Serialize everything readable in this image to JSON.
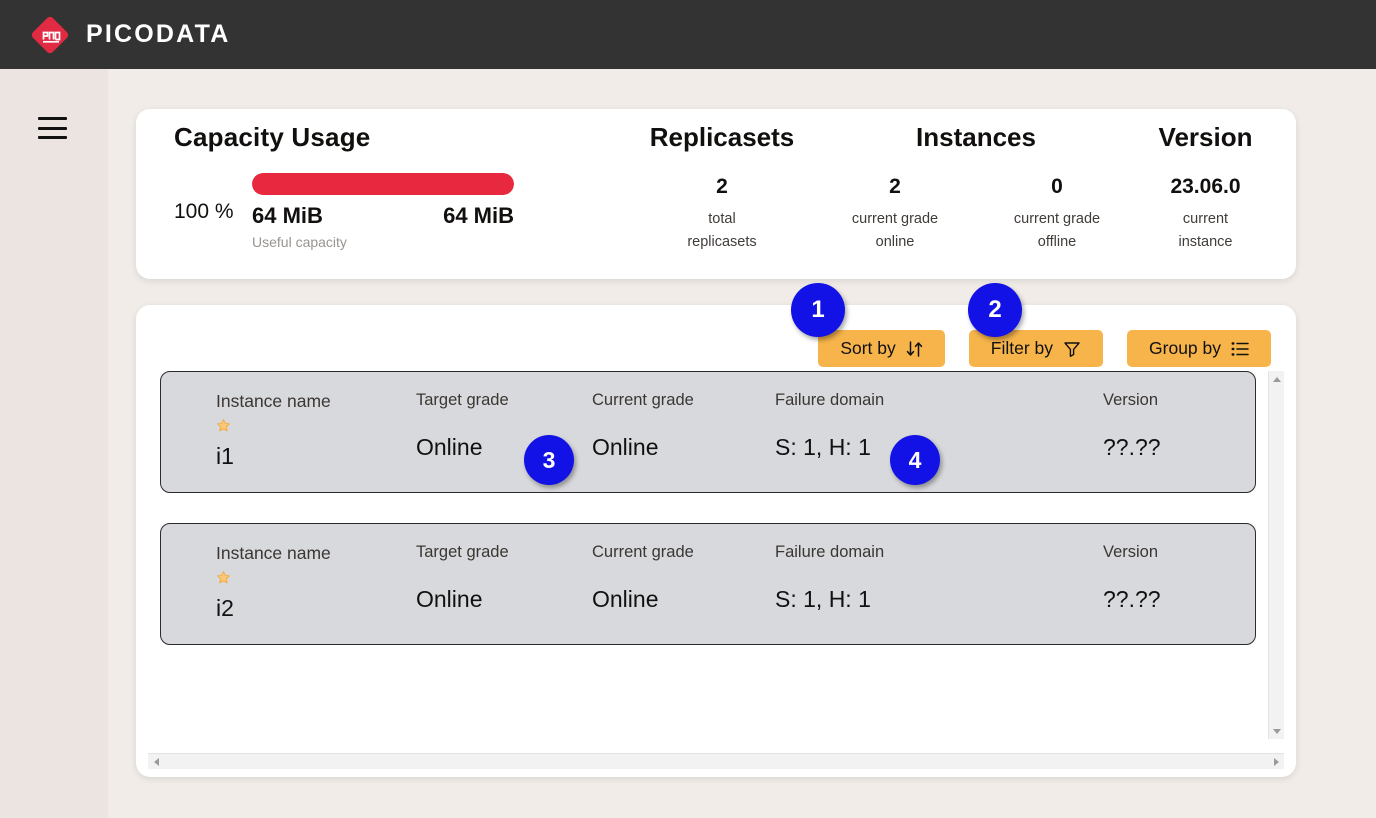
{
  "topbar": {
    "brand": "PICODATA",
    "logo_icon": "picodata-diamond-logo",
    "bg_color": "#333333"
  },
  "sidebar": {
    "menu_icon": "hamburger-menu-icon",
    "bg_color": "#ece4e0"
  },
  "summary": {
    "capacity": {
      "title": "Capacity Usage",
      "percent_label": "100 %",
      "percent_value": 100,
      "used": "64 MiB",
      "total": "64 MiB",
      "sub_label": "Useful capacity",
      "bar_color": "#e8283f"
    },
    "replicasets": {
      "title": "Replicasets",
      "items": [
        {
          "value": "2",
          "label": "total\nreplicasets"
        }
      ]
    },
    "instances": {
      "title": "Instances",
      "items": [
        {
          "value": "2",
          "label": "current grade\nonline"
        },
        {
          "value": "0",
          "label": "current grade\noffline"
        }
      ]
    },
    "version": {
      "title": "Version",
      "items": [
        {
          "value": "23.06.0",
          "label": "current\ninstance"
        }
      ]
    }
  },
  "toolbar": {
    "accent_color": "#f6b44a",
    "buttons": [
      {
        "label": "Sort by",
        "icon": "sort-arrows-icon",
        "name": "sort-by-button"
      },
      {
        "label": "Filter by",
        "icon": "funnel-filter-icon",
        "name": "filter-by-button"
      },
      {
        "label": "Group by",
        "icon": "list-group-icon",
        "name": "group-by-button"
      }
    ]
  },
  "instances_table": {
    "columns": [
      "Instance name",
      "Target grade",
      "Current grade",
      "Failure domain",
      "Version"
    ],
    "rows": [
      {
        "instance_name": "i1",
        "leader_icon": "star-icon",
        "target_grade": "Online",
        "current_grade": "Online",
        "failure_domain": "S: 1, H: 1",
        "version": "??.??"
      },
      {
        "instance_name": "i2",
        "leader_icon": "star-icon",
        "target_grade": "Online",
        "current_grade": "Online",
        "failure_domain": "S: 1, H: 1",
        "version": "??.??"
      }
    ]
  },
  "scrollbars": {
    "vertical": {
      "up_icon": "scroll-up-arrow-icon",
      "down_icon": "scroll-down-arrow-icon"
    },
    "horizontal": {
      "left_icon": "scroll-left-arrow-icon",
      "right_icon": "scroll-right-arrow-icon"
    }
  },
  "annotations": {
    "badge_color": "#1212e6",
    "badges": [
      {
        "number": "1",
        "target": "sort-by-button"
      },
      {
        "number": "2",
        "target": "filter-by-button"
      },
      {
        "number": "3",
        "target": "row-1-target-grade"
      },
      {
        "number": "4",
        "target": "row-1-failure-domain"
      }
    ]
  }
}
